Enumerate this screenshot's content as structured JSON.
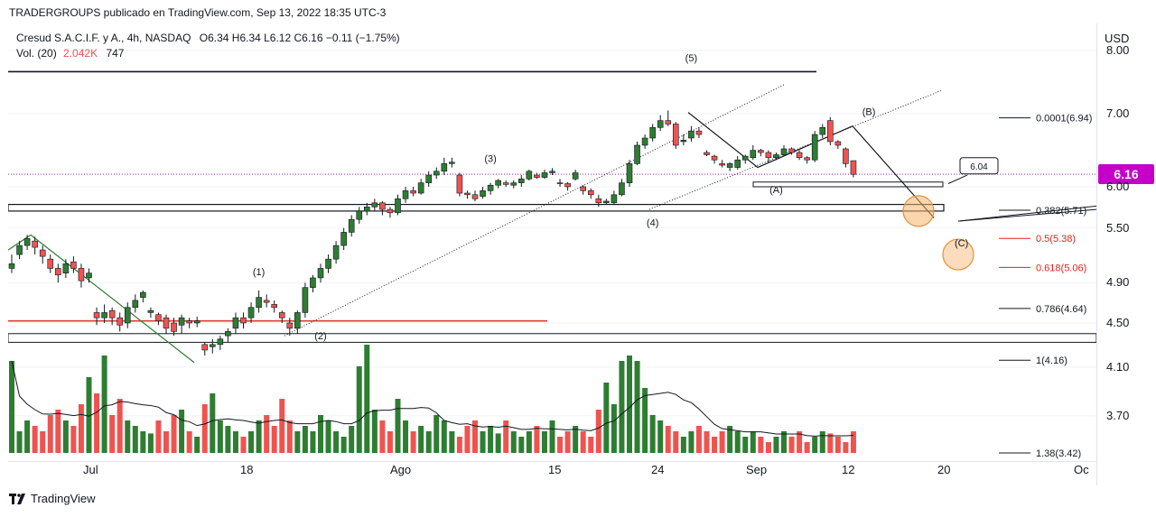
{
  "publisher_line": "TRADERGROUPS publicado en TradingView.com, Sep 13, 2022 18:35 UTC-3",
  "legend": {
    "title": "Cresud S.A.C.I.F. y A., 4h, NASDAQ",
    "ohlc": "O6.34  H6.34  L6.12  C6.16  −0.11  (−1.75%)",
    "vol_label": "Vol. (20)",
    "vol_value": "2.042K",
    "vol_ma": "747"
  },
  "currency": "USD",
  "last_price": "6.16",
  "target_label": "6.04",
  "brand": "TradingView",
  "colors": {
    "up": "#2e7d32",
    "down": "#ef5350",
    "price_badge": "#c400c9",
    "fib_red": "#e91e1e"
  },
  "chart_data": {
    "type": "candlestick",
    "title": "Cresud S.A.C.I.F. y A., 4h, NASDAQ",
    "ylabel": "USD",
    "y_scale": "log",
    "ylim": [
      3.42,
      8.0
    ],
    "y_ticks": [
      "8.00",
      "7.00",
      "6.00",
      "5.50",
      "4.90",
      "4.50",
      "4.10",
      "3.70"
    ],
    "x_ticks": [
      "Jul",
      "18",
      "Ago",
      "15",
      "24",
      "Sep",
      "12",
      "20",
      "Oc"
    ],
    "candles": [
      [
        5.05,
        5.1,
        5.2,
        5.0
      ],
      [
        5.2,
        5.3,
        5.35,
        5.15
      ],
      [
        5.3,
        5.38,
        5.42,
        5.25
      ],
      [
        5.35,
        5.28,
        5.4,
        5.2
      ],
      [
        5.25,
        5.18,
        5.3,
        5.1
      ],
      [
        5.15,
        5.05,
        5.2,
        5.0
      ],
      [
        5.05,
        4.98,
        5.1,
        4.9
      ],
      [
        5.0,
        5.1,
        5.15,
        4.95
      ],
      [
        5.12,
        5.05,
        5.18,
        5.0
      ],
      [
        5.05,
        4.92,
        5.1,
        4.85
      ],
      [
        4.95,
        5.0,
        5.05,
        4.9
      ],
      [
        4.6,
        4.55,
        4.65,
        4.48
      ],
      [
        4.55,
        4.6,
        4.68,
        4.5
      ],
      [
        4.62,
        4.55,
        4.65,
        4.48
      ],
      [
        4.55,
        4.48,
        4.6,
        4.42
      ],
      [
        4.5,
        4.65,
        4.7,
        4.45
      ],
      [
        4.65,
        4.72,
        4.78,
        4.6
      ],
      [
        4.75,
        4.8,
        4.82,
        4.7
      ],
      [
        4.6,
        4.62,
        4.65,
        4.55
      ],
      [
        4.58,
        4.52,
        4.6,
        4.48
      ],
      [
        4.55,
        4.45,
        4.58,
        4.4
      ],
      [
        4.5,
        4.42,
        4.55,
        4.38
      ],
      [
        4.48,
        4.55,
        4.58,
        4.4
      ],
      [
        4.52,
        4.5,
        4.55,
        4.45
      ],
      [
        4.5,
        4.52,
        4.56,
        4.46
      ],
      [
        4.3,
        4.25,
        4.32,
        4.2
      ],
      [
        4.28,
        4.3,
        4.35,
        4.22
      ],
      [
        4.3,
        4.35,
        4.38,
        4.25
      ],
      [
        4.38,
        4.42,
        4.45,
        4.32
      ],
      [
        4.45,
        4.55,
        4.6,
        4.4
      ],
      [
        4.55,
        4.5,
        4.6,
        4.45
      ],
      [
        4.55,
        4.65,
        4.7,
        4.5
      ],
      [
        4.65,
        4.75,
        4.82,
        4.6
      ],
      [
        4.72,
        4.7,
        4.78,
        4.65
      ],
      [
        4.68,
        4.65,
        4.72,
        4.6
      ],
      [
        4.6,
        4.55,
        4.62,
        4.5
      ],
      [
        4.5,
        4.45,
        4.55,
        4.38
      ],
      [
        4.45,
        4.6,
        4.62,
        4.4
      ],
      [
        4.6,
        4.85,
        4.9,
        4.55
      ],
      [
        4.85,
        4.95,
        4.98,
        4.8
      ],
      [
        4.95,
        5.05,
        5.1,
        4.9
      ],
      [
        5.05,
        5.15,
        5.2,
        5.0
      ],
      [
        5.15,
        5.3,
        5.35,
        5.1
      ],
      [
        5.3,
        5.45,
        5.5,
        5.25
      ],
      [
        5.45,
        5.6,
        5.65,
        5.4
      ],
      [
        5.6,
        5.7,
        5.75,
        5.55
      ],
      [
        5.7,
        5.75,
        5.8,
        5.65
      ],
      [
        5.75,
        5.8,
        5.85,
        5.7
      ],
      [
        5.8,
        5.72,
        5.82,
        5.65
      ],
      [
        5.72,
        5.68,
        5.75,
        5.62
      ],
      [
        5.68,
        5.85,
        5.9,
        5.65
      ],
      [
        5.85,
        5.95,
        6.0,
        5.8
      ],
      [
        5.95,
        5.92,
        6.0,
        5.88
      ],
      [
        5.92,
        6.05,
        6.1,
        5.9
      ],
      [
        6.05,
        6.15,
        6.2,
        6.0
      ],
      [
        6.15,
        6.2,
        6.25,
        6.1
      ],
      [
        6.2,
        6.3,
        6.38,
        6.15
      ],
      [
        6.3,
        6.32,
        6.38,
        6.25
      ],
      [
        6.15,
        5.92,
        6.18,
        5.88
      ],
      [
        5.92,
        5.9,
        5.95,
        5.85
      ],
      [
        5.9,
        5.85,
        5.95,
        5.82
      ],
      [
        5.88,
        5.95,
        6.0,
        5.85
      ],
      [
        5.95,
        6.02,
        6.05,
        5.9
      ],
      [
        6.02,
        6.08,
        6.1,
        5.98
      ],
      [
        6.05,
        6.03,
        6.08,
        6.0
      ],
      [
        6.02,
        6.05,
        6.08,
        5.98
      ],
      [
        6.05,
        6.1,
        6.15,
        6.0
      ],
      [
        6.1,
        6.2,
        6.22,
        6.08
      ],
      [
        6.15,
        6.12,
        6.18,
        6.1
      ],
      [
        6.12,
        6.18,
        6.22,
        6.1
      ],
      [
        6.18,
        6.2,
        6.24,
        6.15
      ],
      [
        6.05,
        6.04,
        6.1,
        6.0
      ],
      [
        6.04,
        6.0,
        6.06,
        5.95
      ],
      [
        6.1,
        6.18,
        6.22,
        6.08
      ],
      [
        6.0,
        5.95,
        6.02,
        5.9
      ],
      [
        5.95,
        5.9,
        5.98,
        5.85
      ],
      [
        5.85,
        5.8,
        5.9,
        5.75
      ],
      [
        5.8,
        5.82,
        5.85,
        5.78
      ],
      [
        5.8,
        5.9,
        5.95,
        5.78
      ],
      [
        5.9,
        6.05,
        6.1,
        5.88
      ],
      [
        6.05,
        6.3,
        6.35,
        6.0
      ],
      [
        6.3,
        6.55,
        6.6,
        6.28
      ],
      [
        6.55,
        6.65,
        6.7,
        6.5
      ],
      [
        6.65,
        6.8,
        6.85,
        6.6
      ],
      [
        6.8,
        6.9,
        6.98,
        6.75
      ],
      [
        6.9,
        6.85,
        7.05,
        6.82
      ],
      [
        6.85,
        6.55,
        6.88,
        6.5
      ],
      [
        6.6,
        6.62,
        6.7,
        6.55
      ],
      [
        6.65,
        6.75,
        6.82,
        6.6
      ],
      [
        6.75,
        6.7,
        6.8,
        6.65
      ],
      [
        6.45,
        6.42,
        6.48,
        6.4
      ],
      [
        6.4,
        6.35,
        6.42,
        6.3
      ],
      [
        6.3,
        6.28,
        6.35,
        6.25
      ],
      [
        6.25,
        6.3,
        6.32,
        6.2
      ],
      [
        6.25,
        6.35,
        6.4,
        6.22
      ],
      [
        6.35,
        6.4,
        6.42,
        6.3
      ],
      [
        6.38,
        6.48,
        6.55,
        6.35
      ],
      [
        6.48,
        6.45,
        6.5,
        6.4
      ],
      [
        6.45,
        6.38,
        6.48,
        6.32
      ],
      [
        6.38,
        6.42,
        6.45,
        6.35
      ],
      [
        6.42,
        6.5,
        6.55,
        6.4
      ],
      [
        6.5,
        6.45,
        6.52,
        6.42
      ],
      [
        6.45,
        6.38,
        6.48,
        6.35
      ],
      [
        6.38,
        6.35,
        6.4,
        6.3
      ],
      [
        6.35,
        6.7,
        6.75,
        6.32
      ],
      [
        6.7,
        6.8,
        6.85,
        6.65
      ],
      [
        6.9,
        6.6,
        6.95,
        6.55
      ],
      [
        6.6,
        6.55,
        6.62,
        6.5
      ],
      [
        6.5,
        6.3,
        6.52,
        6.25
      ],
      [
        6.34,
        6.16,
        6.34,
        6.12
      ]
    ],
    "volume": [
      0.85,
      0.2,
      0.3,
      0.25,
      0.2,
      0.35,
      0.4,
      0.3,
      0.25,
      0.45,
      0.7,
      0.55,
      0.9,
      0.35,
      0.5,
      0.3,
      0.25,
      0.2,
      0.18,
      0.3,
      0.2,
      0.35,
      0.4,
      0.2,
      0.15,
      0.45,
      0.55,
      0.3,
      0.25,
      0.2,
      0.15,
      0.2,
      0.3,
      0.35,
      0.25,
      0.5,
      0.3,
      0.2,
      0.25,
      0.2,
      0.35,
      0.3,
      0.2,
      0.15,
      0.25,
      0.8,
      1.0,
      0.4,
      0.3,
      0.2,
      0.5,
      0.3,
      0.2,
      0.25,
      0.2,
      0.35,
      0.3,
      0.2,
      0.15,
      0.25,
      0.3,
      0.2,
      0.25,
      0.18,
      0.3,
      0.2,
      0.15,
      0.2,
      0.25,
      0.2,
      0.3,
      0.15,
      0.2,
      0.25,
      0.2,
      0.15,
      0.4,
      0.65,
      0.45,
      0.85,
      0.9,
      0.85,
      0.6,
      0.35,
      0.3,
      0.25,
      0.2,
      0.15,
      0.2,
      0.25,
      0.2,
      0.15,
      0.2,
      0.25,
      0.2,
      0.15,
      0.2,
      0.15,
      0.1,
      0.15,
      0.2,
      0.15,
      0.2,
      0.1,
      0.15,
      0.2,
      0.18,
      0.15,
      0.1,
      0.2
    ],
    "volume_max": "2.042K",
    "horizontal_levels": [
      {
        "price": 7.65,
        "label": ""
      },
      {
        "price": 5.74,
        "label": ""
      },
      {
        "price": 4.52,
        "label": ""
      },
      {
        "price": 4.36,
        "label": ""
      }
    ],
    "fib_levels": [
      {
        "label": "0.0001(6.94)",
        "price": 6.94,
        "color": "#131722"
      },
      {
        "label": "0.382(5.71)",
        "price": 5.71,
        "color": "#131722"
      },
      {
        "label": "0.5(5.38)",
        "price": 5.38,
        "color": "#e91e1e"
      },
      {
        "label": "0.618(5.06)",
        "price": 5.06,
        "color": "#e91e1e"
      },
      {
        "label": "0.786(4.64)",
        "price": 4.64,
        "color": "#131722"
      },
      {
        "label": "1(4.16)",
        "price": 4.16,
        "color": "#131722"
      },
      {
        "label": "1.38(3.42)",
        "price": 3.42,
        "color": "#131722"
      }
    ],
    "wave_labels": [
      {
        "label": "(1)",
        "x": 32,
        "price": 4.98
      },
      {
        "label": "(2)",
        "x": 40,
        "price": 4.35
      },
      {
        "label": "(3)",
        "x": 62,
        "price": 6.32
      },
      {
        "label": "(4)",
        "x": 83,
        "price": 5.52
      },
      {
        "label": "(5)",
        "x": 88,
        "price": 7.82
      },
      {
        "label": "(A)",
        "x": 99,
        "price": 5.92
      },
      {
        "label": "(B)",
        "x": 111,
        "price": 6.98
      },
      {
        "label": "(C)",
        "x": 123,
        "price": 5.29
      }
    ]
  }
}
